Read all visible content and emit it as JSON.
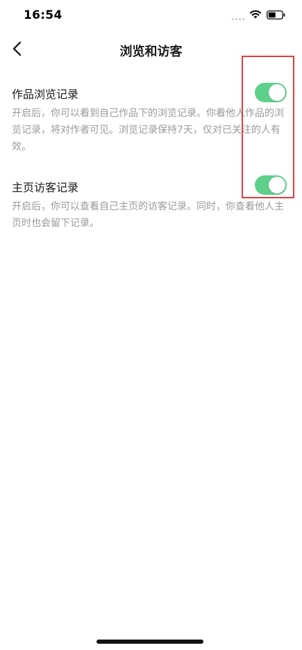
{
  "status_bar": {
    "time": "16:54"
  },
  "nav": {
    "title": "浏览和访客"
  },
  "settings": [
    {
      "title": "作品浏览记录",
      "description": "开启后，你可以看到自己作品下的浏览记录。你看他人作品的浏览记录，将对作者可见。浏览记录保持7天，仅对已关注的人有效。",
      "enabled": true
    },
    {
      "title": "主页访客记录",
      "description": "开启后，你可以查看自己主页的访客记录。同时，你查看他人主页时也会留下记录。",
      "enabled": true
    }
  ],
  "colors": {
    "toggle_on": "#5ed08c",
    "annotation": "#e23b3b",
    "description_text": "#9a9a9a"
  }
}
